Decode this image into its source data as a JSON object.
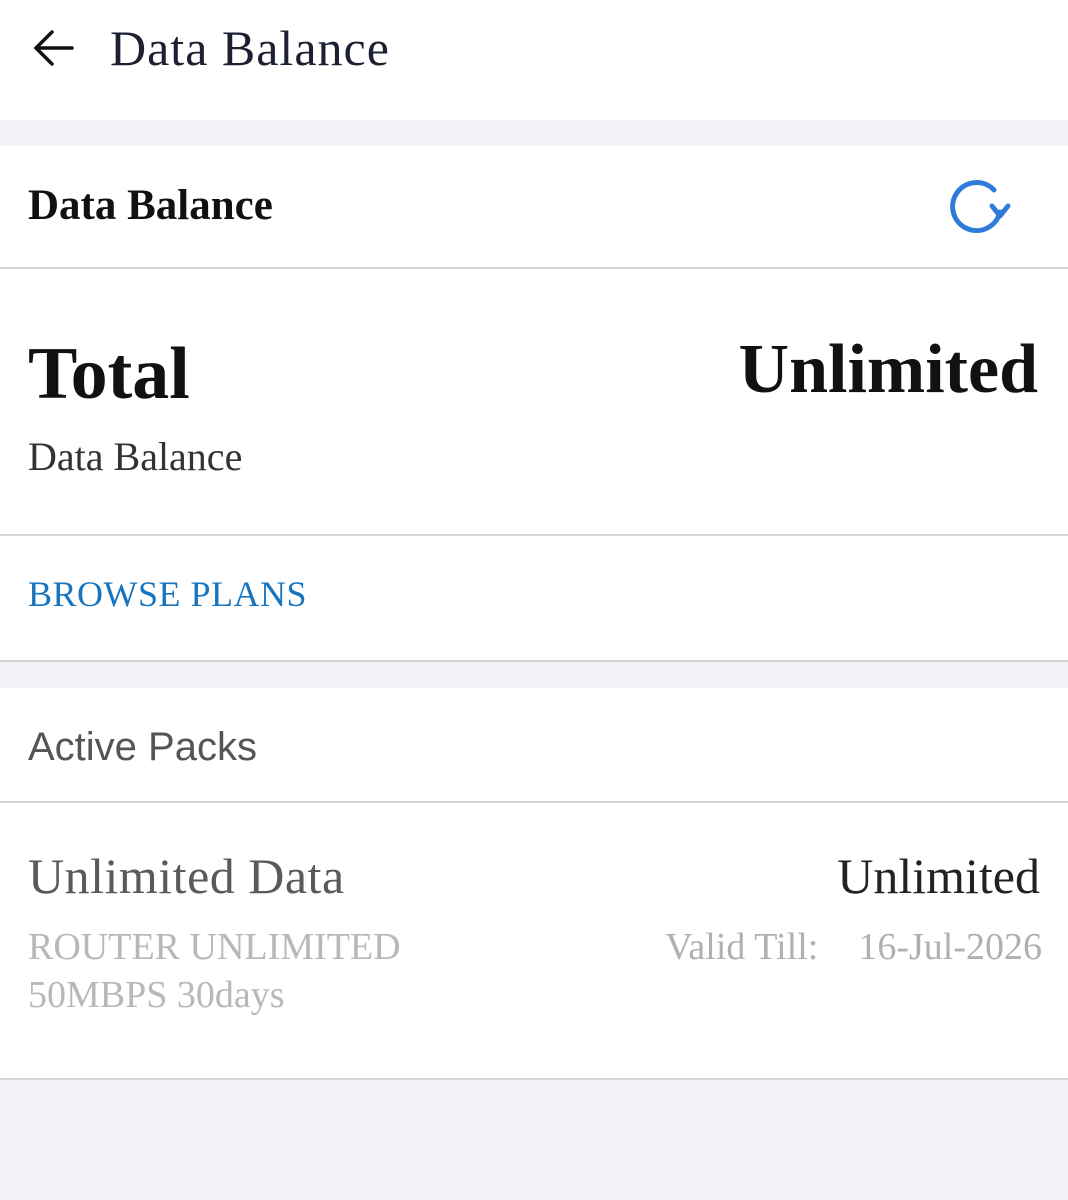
{
  "header": {
    "title": "Data Balance",
    "back_icon": "arrow-left-icon"
  },
  "balance": {
    "section_title": "Data Balance",
    "refresh_icon": "refresh-icon",
    "accent_color": "#2f7bd9",
    "total_label": "Total",
    "total_value": "Unlimited",
    "total_sub": "Data Balance",
    "browse_label": "BROWSE PLANS"
  },
  "active_packs": {
    "title": "Active Packs",
    "items": [
      {
        "name": "Unlimited Data",
        "amount": "Unlimited",
        "description": "ROUTER UNLIMITED 50MBPS 30days",
        "valid_label": "Valid Till:",
        "valid_date": "16-Jul-2026"
      }
    ]
  }
}
